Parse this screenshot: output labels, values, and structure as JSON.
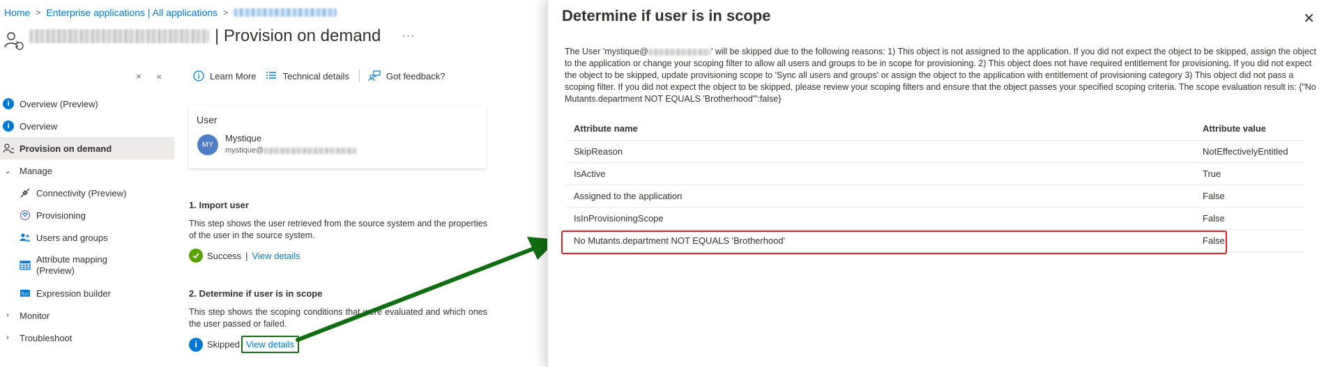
{
  "breadcrumb": {
    "home": "Home",
    "enterprise_apps": "Enterprise applications | All applications"
  },
  "header": {
    "title": "| Provision on demand",
    "more": "···"
  },
  "sidenav": {
    "collapse_close": "×",
    "collapse_chevron": "«",
    "items": [
      {
        "label": "Overview (Preview)"
      },
      {
        "label": "Overview"
      },
      {
        "label": "Provision on demand"
      },
      {
        "label": "Manage"
      },
      {
        "label": "Connectivity (Preview)"
      },
      {
        "label": "Provisioning"
      },
      {
        "label": "Users and groups"
      },
      {
        "label": "Attribute mapping (Preview)"
      },
      {
        "label": "Expression builder"
      },
      {
        "label": "Monitor"
      },
      {
        "label": "Troubleshoot"
      }
    ]
  },
  "toolbar": {
    "learn_more": "Learn More",
    "technical_details": "Technical details",
    "feedback": "Got feedback?"
  },
  "user_card": {
    "label": "User",
    "initials": "MY",
    "name": "Mystique",
    "email_prefix": "mystique@"
  },
  "steps": [
    {
      "title": "1. Import user",
      "description": "This step shows the user retrieved from the source system and the properties of the user in the source system.",
      "status": "Success",
      "link": "View details"
    },
    {
      "title": "2. Determine if user is in scope",
      "description": "This step shows the scoping conditions that were evaluated and which ones the user passed or failed.",
      "status": "Skipped",
      "link": "View details"
    }
  ],
  "blade": {
    "title": "Determine if user is in scope",
    "close": "✕",
    "reason_prefix": "The User 'mystique@",
    "reason_suffix": "' will be skipped due to the following reasons: 1) This object is not assigned to the application. If you did not expect the object to be skipped, assign the object to the application or change your scoping filter to allow all users and groups to be in scope for provisioning. 2) This object does not have required entitlement for provisioning. If you did not expect the object to be skipped, update provisioning scope to 'Sync all users and groups' or assign the object to the application with entitlement of provisioning category 3) This object did not pass a scoping filter. If you did not expect the object to be skipped, please review your scoping filters and ensure that the object passes your specified scoping criteria. The scope evaluation result is: {\"No Mutants.department NOT EQUALS 'Brotherhood'\":false}",
    "table": {
      "headers": [
        "Attribute name",
        "Attribute value"
      ],
      "rows": [
        [
          "SkipReason",
          "NotEffectivelyEntitled"
        ],
        [
          "IsActive",
          "True"
        ],
        [
          "Assigned to the application",
          "False"
        ],
        [
          "IsInProvisioningScope",
          "False"
        ],
        [
          "No Mutants.department NOT EQUALS 'Brotherhood'",
          "False"
        ]
      ]
    }
  },
  "colors": {
    "accent": "#0078d4",
    "success": "#57a300",
    "highlight_green": "#116d11",
    "highlight_red": "#e02020"
  }
}
